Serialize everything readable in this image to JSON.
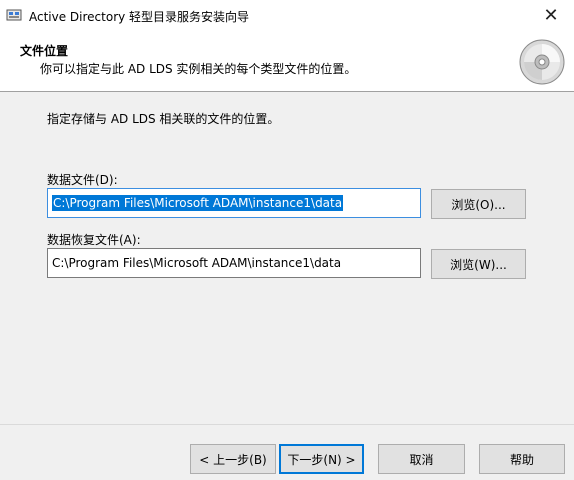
{
  "window": {
    "title": "Active Directory 轻型目录服务安装向导",
    "close_symbol": "✕",
    "app_icon": "directory-app-icon"
  },
  "header": {
    "title": "文件位置",
    "subtitle": "你可以指定与此 AD LDS 实例相关的每个类型文件的位置。",
    "icon": "cd-disc-icon"
  },
  "main": {
    "intro": "指定存储与 AD LDS 相关联的文件的位置。",
    "data_files": {
      "label": "数据文件(D):",
      "value": "C:\\Program Files\\Microsoft ADAM\\instance1\\data",
      "browse": "浏览(O)..."
    },
    "recovery_files": {
      "label": "数据恢复文件(A):",
      "value": "C:\\Program Files\\Microsoft ADAM\\instance1\\data",
      "browse": "浏览(W)..."
    }
  },
  "footer": {
    "back": "< 上一步(B)",
    "next": "下一步(N) >",
    "cancel": "取消",
    "help": "帮助"
  }
}
